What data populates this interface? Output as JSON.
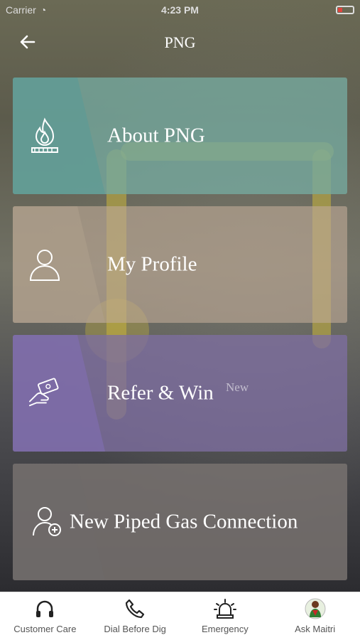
{
  "status": {
    "carrier": "Carrier",
    "time": "4:23 PM"
  },
  "header": {
    "title": "PNG"
  },
  "menu": [
    {
      "label": "About PNG",
      "icon": "gas-flame-icon"
    },
    {
      "label": "My Profile",
      "icon": "user-icon"
    },
    {
      "label": "Refer & Win",
      "badge": "New",
      "icon": "hand-money-icon"
    },
    {
      "label": "New Piped Gas Connection",
      "icon": "add-user-icon"
    }
  ],
  "tabs": [
    {
      "label": "Customer Care",
      "icon": "headphones-icon"
    },
    {
      "label": "Dial Before Dig",
      "icon": "phone-icon"
    },
    {
      "label": "Emergency",
      "icon": "siren-icon"
    },
    {
      "label": "Ask Maitri",
      "icon": "assistant-avatar-icon"
    }
  ]
}
